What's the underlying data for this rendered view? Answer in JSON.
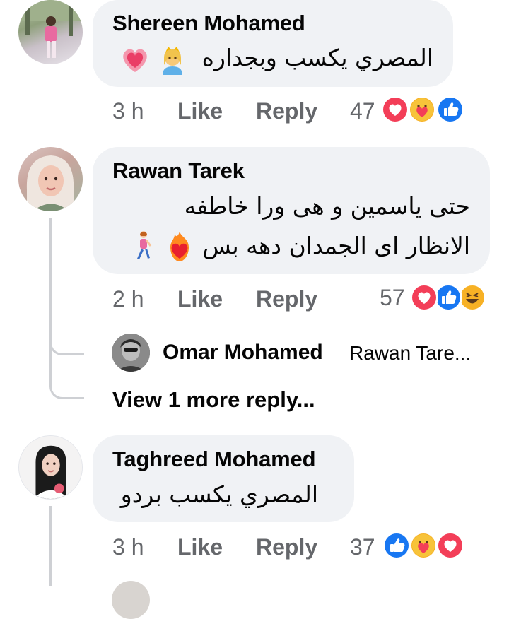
{
  "comments": [
    {
      "author": "Shereen Mohamed",
      "text": "المصري يكسب وبجداره",
      "time": "3 h",
      "like": "Like",
      "reply": "Reply",
      "reaction_count": "47",
      "reactions": [
        "love",
        "care",
        "like"
      ]
    },
    {
      "author": "Rawan Tarek",
      "text_line1": "حتى ياسمين و هى ورا خاطفه",
      "text_line2": "الانظار اى الجمدان دهه بس",
      "time": "2 h",
      "like": "Like",
      "reply": "Reply",
      "reaction_count": "57",
      "reactions": [
        "love",
        "like",
        "haha"
      ],
      "reply_preview": {
        "author": "Omar Mohamed",
        "snippet": "Rawan Tare..."
      },
      "view_more": "View 1 more reply..."
    },
    {
      "author": "Taghreed Mohamed",
      "text": "المصري يكسب بردو",
      "time": "3 h",
      "like": "Like",
      "reply": "Reply",
      "reaction_count": "37",
      "reactions": [
        "like",
        "care",
        "love"
      ]
    }
  ],
  "colors": {
    "bubble": "#f0f2f5",
    "secondary_text": "#65676b",
    "like_blue": "#1877f2",
    "love_red": "#f33e58",
    "haha_yellow": "#f7b125"
  }
}
